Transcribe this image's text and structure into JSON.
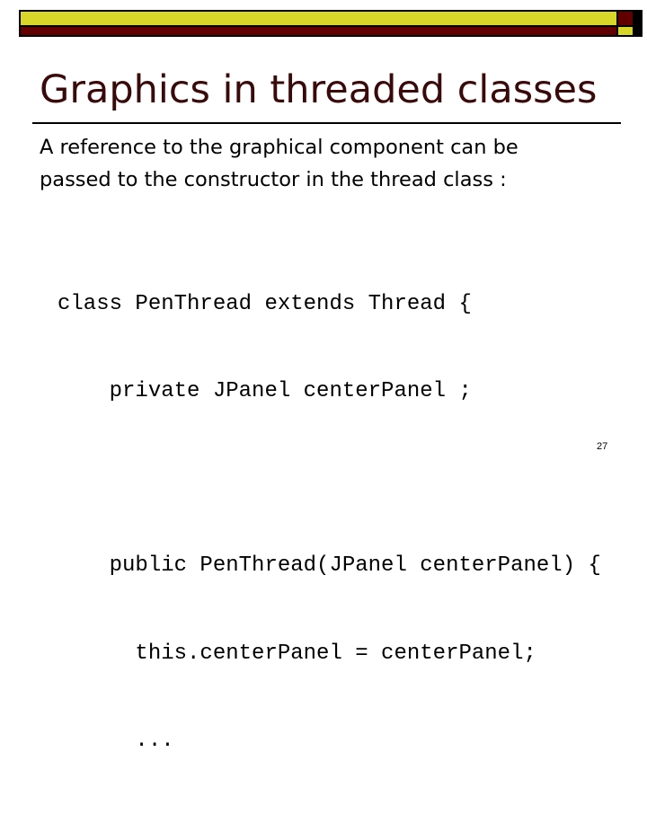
{
  "slide": {
    "title": "Graphics in threaded classes",
    "body_lines": [
      "A reference to the graphical component can be",
      "passed to the constructor in the thread class :"
    ],
    "code_lines": [
      "class PenThread extends Thread {",
      "    private JPanel centerPanel ;",
      "",
      "    public PenThread(JPanel centerPanel) {",
      "      this.centerPanel = centerPanel;",
      "      ..."
    ],
    "page_number": "27"
  },
  "theme": {
    "accent_yellow": "#d8d629",
    "accent_maroon": "#620000",
    "title_color": "#3a0a0a"
  }
}
